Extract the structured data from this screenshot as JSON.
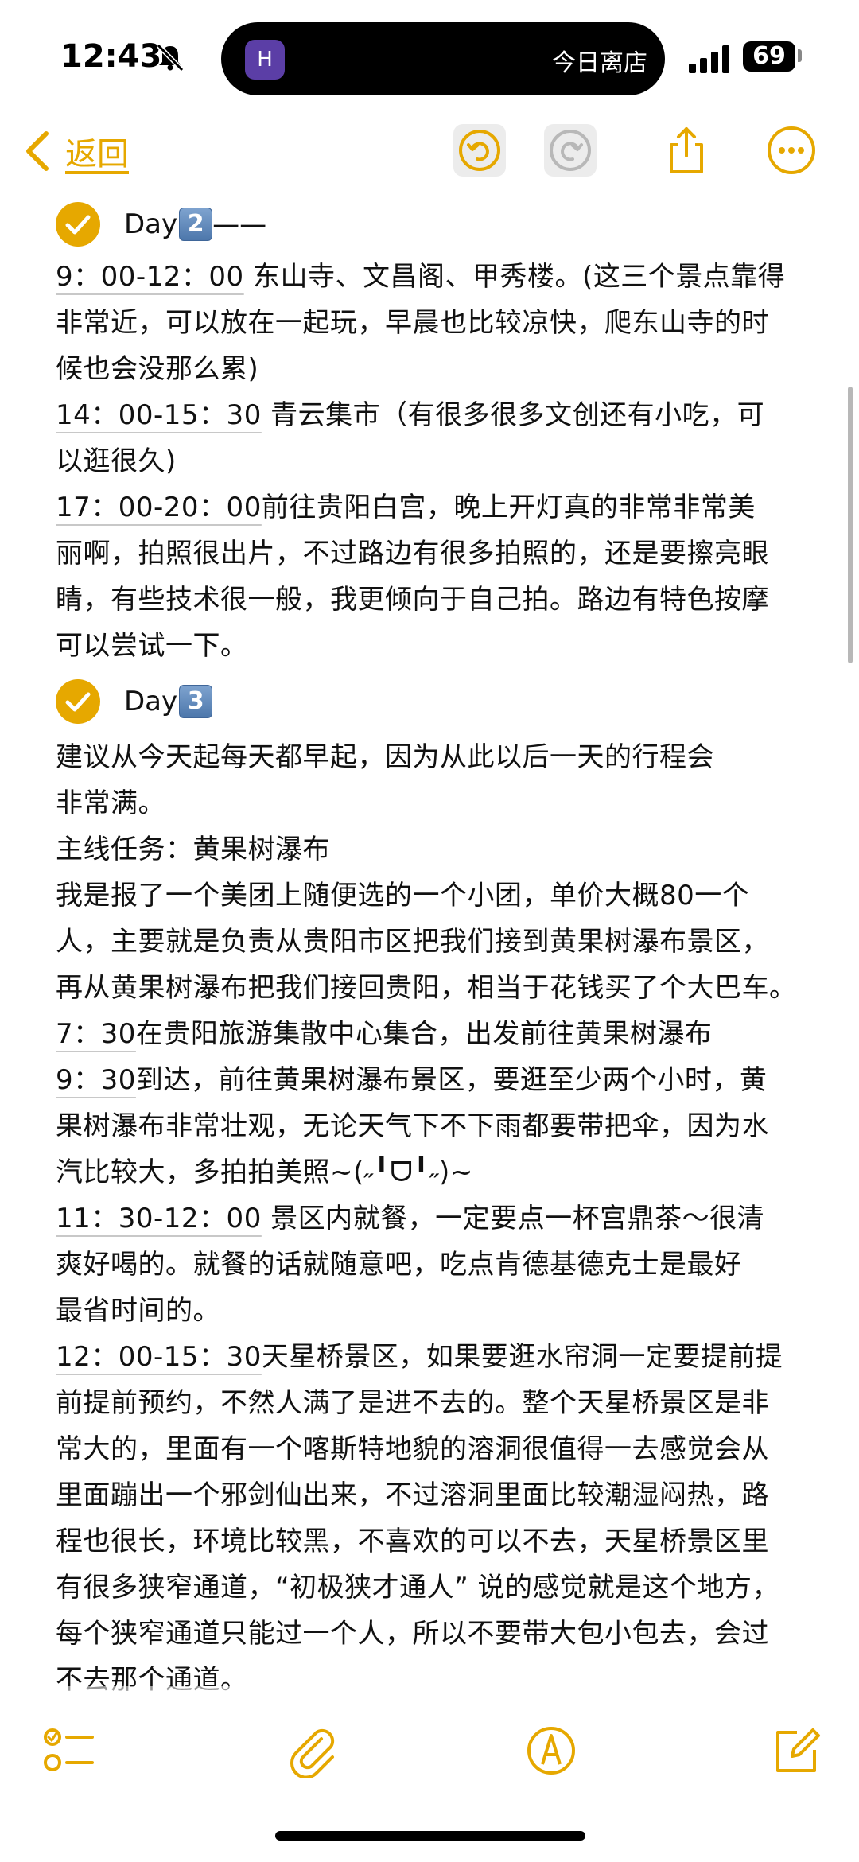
{
  "status_bar": {
    "time": "12:43",
    "island_text": "今日离店",
    "island_app_icon": "H",
    "battery": "69"
  },
  "nav": {
    "back_label": "返回"
  },
  "colors": {
    "accent": "#e6a800"
  },
  "content": {
    "day2_title": "Day",
    "day2_num": "2",
    "day2_suffix": "——",
    "day2_lines": [
      [
        "9：00-12：00",
        "  东山寺、文昌阁、甲秀楼。(这三个景点靠得"
      ],
      [
        "",
        "非常近，可以放在一起玩，早晨也比较凉快，爬东山寺的时"
      ],
      [
        "",
        "候也会没那么累)"
      ],
      [
        "14：00-15：30",
        "  青云集市（有很多很多文创还有小吃，可"
      ],
      [
        "",
        "以逛很久)"
      ],
      [
        "17：00-20：00",
        "前往贵阳白宫，晚上开灯真的非常非常美"
      ],
      [
        "",
        "丽啊，拍照很出片，不过路边有很多拍照的，还是要擦亮眼"
      ],
      [
        "",
        "睛，有些技术很一般，我更倾向于自己拍。路边有特色按摩"
      ],
      [
        "",
        "可以尝试一下。"
      ]
    ],
    "day3_title": "Day",
    "day3_num": "3",
    "day3_lines": [
      [
        "",
        "建议从今天起每天都早起，因为从此以后一天的行程会"
      ],
      [
        "",
        "非常满。"
      ],
      [
        "",
        "主线任务：黄果树瀑布"
      ],
      [
        "",
        "我是报了一个美团上随便选的一个小团，单价大概80一个"
      ],
      [
        "",
        "人，主要就是负责从贵阳市区把我们接到黄果树瀑布景区，"
      ],
      [
        "",
        "再从黄果树瀑布把我们接回贵阳，相当于花钱买了个大巴车。"
      ],
      [
        "7：30",
        "在贵阳旅游集散中心集合，出发前往黄果树瀑布"
      ],
      [
        "9：30",
        "到达，前往黄果树瀑布景区，要逛至少两个小时，黄"
      ],
      [
        "",
        "果树瀑布非常壮观，无论天气下不下雨都要带把伞，因为水"
      ],
      [
        "",
        "汽比较大，多拍拍美照~(˶╹ᗜ╹˶)~"
      ],
      [
        "11：30-12：00",
        "  景区内就餐，一定要点一杯宫鼎茶～很清"
      ],
      [
        "",
        "爽好喝的。就餐的话就随意吧，吃点肯德基德克士是最好"
      ],
      [
        "",
        "最省时间的。"
      ],
      [
        "12：00-15：30",
        "天星桥景区，如果要逛水帘洞一定要提前提"
      ],
      [
        "",
        "前提前预约，不然人满了是进不去的。整个天星桥景区是非"
      ],
      [
        "",
        "常大的，里面有一个喀斯特地貌的溶洞很值得一去感觉会从"
      ],
      [
        "",
        "里面蹦出一个邪剑仙出来，不过溶洞里面比较潮湿闷热，路"
      ],
      [
        "",
        "程也很长，环境比较黑，不喜欢的可以不去，天星桥景区里"
      ],
      [
        "",
        "有很多狭窄通道，“初极狭才通人” 说的感觉就是这个地方，"
      ],
      [
        "",
        "每个狭窄通道只能过一个人，所以不要带大包小包去，会过"
      ],
      [
        "",
        "不去那个通道。"
      ]
    ]
  },
  "toolbar": {
    "icons": [
      "checklist-icon",
      "paperclip-icon",
      "markup-pen-icon",
      "compose-icon"
    ]
  }
}
